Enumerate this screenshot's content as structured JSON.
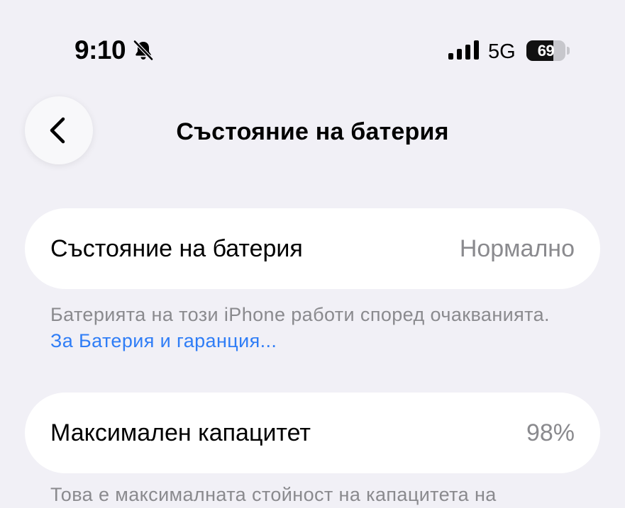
{
  "status_bar": {
    "time": "9:10",
    "network": "5G",
    "battery_level": "69",
    "icons": [
      "bell-slash-icon",
      "cellular-signal-icon",
      "battery-icon"
    ]
  },
  "navigation": {
    "back_icon": "chevron-left-icon",
    "title": "Състояние на батерия"
  },
  "battery_health": {
    "label": "Състояние на батерия",
    "value": "Нормално",
    "footnote_text": "Батерията на този iPhone работи според очакванията. ",
    "footnote_link": "За Батерия и гаранция..."
  },
  "maximum_capacity": {
    "label": "Максимален капацитет",
    "value": "98%",
    "footnote_text": "Това е максималната стойност на капацитета на"
  },
  "colors": {
    "background": "#f1f0f6",
    "card": "#ffffff",
    "secondary_text": "#8a8a8e",
    "link": "#2f7df6"
  }
}
